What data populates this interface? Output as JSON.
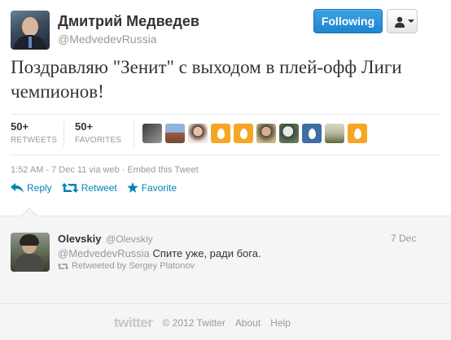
{
  "header": {
    "name": "Дмитрий Медведев",
    "handle": "@MedvedevRussia",
    "follow_button": "Following"
  },
  "tweet": {
    "text": "Поздравляю \"Зенит\" с выходом в плей-офф Лиги чемпионов!",
    "retweets_count": "50+",
    "retweets_label": "RETWEETS",
    "favorites_count": "50+",
    "favorites_label": "FAVORITES",
    "timestamp": "1:52 AM - 7 Dec 11 via web · Embed this Tweet"
  },
  "actions": {
    "reply": "Reply",
    "retweet": "Retweet",
    "favorite": "Favorite"
  },
  "reply": {
    "name": "Olevskiy",
    "handle": "@Olevskiy",
    "date": "7 Dec",
    "mention": "@MedvedevRussia",
    "text": "Спите уже, ради бога.",
    "retweeted_by": "Retweeted by Sergey Platonov"
  },
  "footer": {
    "logo": "twitter",
    "copyright": "© 2012 Twitter",
    "about": "About",
    "help": "Help"
  },
  "colors": {
    "accent": "#0084b4",
    "follow_button": "#2b94d8",
    "egg": "#f5a623"
  },
  "favoriter_avatars": [
    "photo-icon",
    "photo-icon",
    "photo-icon",
    "egg-icon",
    "egg-icon",
    "photo-icon",
    "photo-icon",
    "egg-icon",
    "photo-icon",
    "egg-icon"
  ]
}
